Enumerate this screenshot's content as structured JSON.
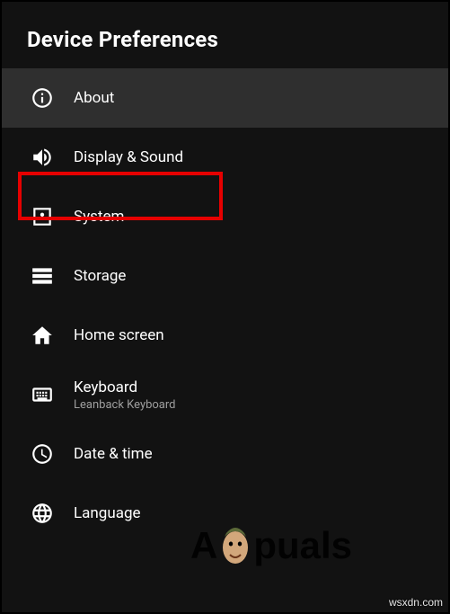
{
  "header": {
    "title": "Device Preferences"
  },
  "items": [
    {
      "id": "about",
      "label": "About",
      "sublabel": null,
      "selected": true
    },
    {
      "id": "display-sound",
      "label": "Display & Sound",
      "sublabel": null,
      "selected": false,
      "highlighted": true
    },
    {
      "id": "system",
      "label": "System",
      "sublabel": null,
      "selected": false
    },
    {
      "id": "storage",
      "label": "Storage",
      "sublabel": null,
      "selected": false
    },
    {
      "id": "home-screen",
      "label": "Home screen",
      "sublabel": null,
      "selected": false
    },
    {
      "id": "keyboard",
      "label": "Keyboard",
      "sublabel": "Leanback Keyboard",
      "selected": false
    },
    {
      "id": "date-time",
      "label": "Date & time",
      "sublabel": null,
      "selected": false
    },
    {
      "id": "language",
      "label": "Language",
      "sublabel": null,
      "selected": false
    }
  ],
  "watermark": {
    "site": "wsxdn.com",
    "brand_prefix": "A",
    "brand_suffix": "puals"
  }
}
